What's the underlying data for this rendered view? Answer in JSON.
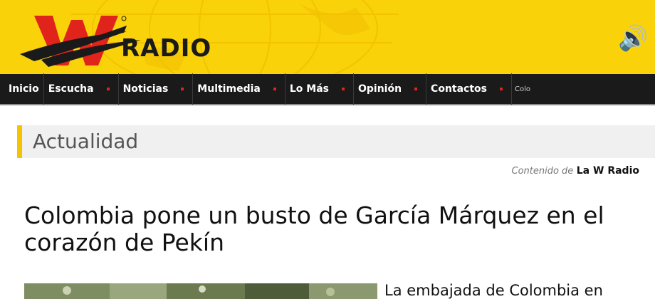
{
  "header": {
    "logo_letter": "W",
    "logo_word": "RADIO",
    "speaker_icon": "speaker-volume-icon"
  },
  "nav": {
    "items": [
      {
        "label": "Inicio",
        "has_caret": false
      },
      {
        "label": "Escucha",
        "has_caret": true
      },
      {
        "label": "Noticias",
        "has_caret": true
      },
      {
        "label": "Multimedia",
        "has_caret": true
      },
      {
        "label": "Lo Más",
        "has_caret": true
      },
      {
        "label": "Opinión",
        "has_caret": true
      },
      {
        "label": "Contactos",
        "has_caret": true
      },
      {
        "label": "Colo",
        "has_caret": false
      }
    ]
  },
  "section": {
    "title": "Actualidad"
  },
  "credit": {
    "prefix": "Contenido de",
    "brand": "La W Radio"
  },
  "article": {
    "headline": "Colombia pone un busto de García Márquez en el corazón de Pekín",
    "lead_text": "La embajada de Colombia en"
  },
  "colors": {
    "header_bg": "#f9d20a",
    "nav_bg": "#1a1a1a",
    "accent_red": "#e0241b",
    "section_bar": "#f5c400"
  }
}
